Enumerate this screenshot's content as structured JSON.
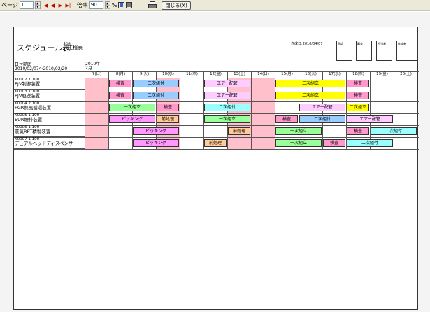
{
  "toolbar": {
    "page_label": "ページ",
    "page_value": "1",
    "zoom_label": "倍率",
    "zoom_value": "90",
    "zoom_unit": "%",
    "close_label": "閉じる(X)"
  },
  "report": {
    "title": "スケジュール表",
    "title_small": "ﾀｲﾄﾙ",
    "title_sub": "工程表",
    "created": "作成日:2010/04/07",
    "stamps": [
      "承認",
      "審査",
      "担当者",
      "作成者"
    ],
    "period_label": "日付範囲",
    "period_value": "2010/02/07～2010/02/20",
    "year_label": "2010年",
    "month_label": "2月",
    "days": [
      "7(日)",
      "8(月)",
      "9(火)",
      "10(水)",
      "11(木)",
      "12(金)",
      "13(土)",
      "14(日)",
      "15(月)",
      "16(火)",
      "17(水)",
      "18(木)",
      "19(金)",
      "20(土)"
    ],
    "pink_days": [
      0,
      3,
      6,
      7
    ]
  },
  "rows": [
    {
      "code": "K0002",
      "qty": "1,100",
      "name": "PJV制御装置"
    },
    {
      "code": "K0003",
      "qty": "1,100",
      "name": "PJV駆送装置"
    },
    {
      "code": "K0004",
      "qty": "2,100",
      "name": "FGR熱風循環装置"
    },
    {
      "code": "K0005",
      "qty": "1,100",
      "name": "EUR煙排装置"
    },
    {
      "code": "K0006",
      "qty": "1,100",
      "name": "蒸気RPT精製装置"
    },
    {
      "code": "K0007",
      "qty": "1,100",
      "name": "デュアルヘッドディスペンサー"
    }
  ],
  "bars": [
    {
      "row": 0,
      "start": 1,
      "span": 1,
      "text": "検査",
      "color": "#ff99cc"
    },
    {
      "row": 0,
      "start": 2,
      "span": 2,
      "text": "二次組付",
      "color": "#99ccff"
    },
    {
      "row": 0,
      "start": 5,
      "span": 2,
      "text": "エアー配管",
      "color": "#ffccff"
    },
    {
      "row": 0,
      "start": 8,
      "span": 3,
      "text": "二次組立",
      "color": "#ffff00"
    },
    {
      "row": 0,
      "start": 11,
      "span": 1,
      "text": "検査",
      "color": "#ff99cc"
    },
    {
      "row": 1,
      "start": 1,
      "span": 1,
      "text": "検査",
      "color": "#ff99cc"
    },
    {
      "row": 1,
      "start": 2,
      "span": 2,
      "text": "二次組付",
      "color": "#99ccff"
    },
    {
      "row": 1,
      "start": 5,
      "span": 2,
      "text": "エアー配管",
      "color": "#ffccff"
    },
    {
      "row": 1,
      "start": 8,
      "span": 3,
      "text": "二次組立",
      "color": "#ffff00"
    },
    {
      "row": 1,
      "start": 11,
      "span": 1,
      "text": "検査",
      "color": "#ff99cc"
    },
    {
      "row": 2,
      "start": 1,
      "span": 2,
      "text": "一次組立",
      "color": "#99ff99"
    },
    {
      "row": 2,
      "start": 3,
      "span": 1,
      "text": "検査",
      "color": "#ff99cc"
    },
    {
      "row": 2,
      "start": 5,
      "span": 2,
      "text": "二次組付",
      "color": "#99ffff"
    },
    {
      "row": 2,
      "start": 9,
      "span": 2,
      "text": "エアー配管",
      "color": "#ffccff"
    },
    {
      "row": 2,
      "start": 11,
      "span": 1,
      "text": "二次組立",
      "color": "#ffff00"
    },
    {
      "row": 3,
      "start": 1,
      "span": 2,
      "text": "ピッキング",
      "color": "#ff99ff"
    },
    {
      "row": 3,
      "start": 3,
      "span": 1,
      "text": "前処理",
      "color": "#ffcc99"
    },
    {
      "row": 3,
      "start": 5,
      "span": 2,
      "text": "一次組立",
      "color": "#99ff99"
    },
    {
      "row": 3,
      "start": 8,
      "span": 1,
      "text": "検査",
      "color": "#ff99cc"
    },
    {
      "row": 3,
      "start": 9,
      "span": 2,
      "text": "二次組付",
      "color": "#99ccff"
    },
    {
      "row": 3,
      "start": 11,
      "span": 2,
      "text": "エアー配管",
      "color": "#ffccff"
    },
    {
      "row": 4,
      "start": 2,
      "span": 2,
      "text": "ピッキング",
      "color": "#ff99ff"
    },
    {
      "row": 4,
      "start": 6,
      "span": 1,
      "text": "前処理",
      "color": "#ffcc99"
    },
    {
      "row": 4,
      "start": 8,
      "span": 2,
      "text": "一次組立",
      "color": "#99ff99"
    },
    {
      "row": 4,
      "start": 11,
      "span": 1,
      "text": "検査",
      "color": "#ff99cc"
    },
    {
      "row": 4,
      "start": 12,
      "span": 2,
      "text": "二次組付",
      "color": "#99ffff"
    },
    {
      "row": 5,
      "start": 2,
      "span": 2,
      "text": "ピッキング",
      "color": "#ff99ff"
    },
    {
      "row": 5,
      "start": 5,
      "span": 1,
      "text": "前処理",
      "color": "#ffcc99"
    },
    {
      "row": 5,
      "start": 8,
      "span": 2,
      "text": "一次組立",
      "color": "#99ff99"
    },
    {
      "row": 5,
      "start": 10,
      "span": 1,
      "text": "検査",
      "color": "#ff99cc"
    },
    {
      "row": 5,
      "start": 11,
      "span": 2,
      "text": "二次組付",
      "color": "#99ffff"
    }
  ],
  "colors": {
    "holiday": "#ffc0cb",
    "page": "#ffffff",
    "frame": "#f4f4f4"
  }
}
